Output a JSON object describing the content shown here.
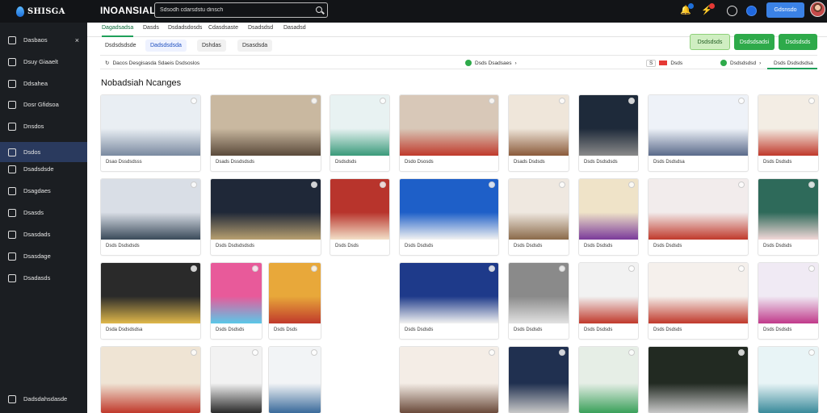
{
  "app": {
    "logo_text": "SHISGA",
    "title": "INOANSIAL"
  },
  "search": {
    "placeholder": "Sdsodh cdarsdstu dinsch"
  },
  "topbar": {
    "button_label": "Gdsnsdo"
  },
  "sidebar": {
    "items": [
      {
        "label": "Dasbaos",
        "icon": "home-icon"
      },
      {
        "label": "Dsuy Giaaelt",
        "icon": "square-icon"
      },
      {
        "label": "Ddsahea",
        "icon": "list-icon"
      },
      {
        "label": "Dosr Gfidsoa",
        "icon": "circle-icon"
      },
      {
        "label": "Dnsdos",
        "icon": "box-icon"
      },
      {
        "label": "Dsdos",
        "icon": "image-icon"
      },
      {
        "label": "Dsadsdsde",
        "icon": "doc-icon"
      },
      {
        "label": "Dsagdaes",
        "icon": "grid-icon"
      },
      {
        "label": "Dsasds",
        "icon": "page-icon"
      },
      {
        "label": "Dsasdads",
        "icon": "folder-icon"
      },
      {
        "label": "Dsasdage",
        "icon": "box-icon"
      },
      {
        "label": "Dsadasds",
        "icon": "share-icon"
      }
    ],
    "footer_label": "Dadsdahsdasde"
  },
  "tabs": [
    {
      "label": "Dagadsadsa"
    },
    {
      "label": "Dasds"
    },
    {
      "label": "Dsdadsdosds"
    },
    {
      "label": "Cdasdsaste"
    },
    {
      "label": "Dsadsdsd"
    },
    {
      "label": "Dasadsd"
    }
  ],
  "subtabs": [
    {
      "label": "Dsdsdsdsde"
    },
    {
      "label": "Dadsdsdsda"
    },
    {
      "label": "Dshdas"
    },
    {
      "label": "Dsasdsda"
    }
  ],
  "actions": [
    {
      "label": "Dsdsdsds"
    },
    {
      "label": "Dsdsdsadsi"
    },
    {
      "label": "Dsdsdsds"
    }
  ],
  "filters": {
    "left": "Dacos Desgisasda Sdaeis Dsdsoslos",
    "status": "Dsds Dsadsaes",
    "sort_left": "S",
    "sort_label": "Dsds",
    "count_label": "Dsdsdsdsd",
    "right_label": "Dsds Dsdsdsdsa"
  },
  "page_title": "Nobadsiah Ncanges",
  "gallery": [
    {
      "caption": "Dsao Dssdsdsss",
      "palette": [
        "#e9eef3",
        "#7a8aa0"
      ]
    },
    {
      "caption": "Dsads Dssdsdsds",
      "palette": [
        "#c9b8a0",
        "#5a4a3a"
      ]
    },
    {
      "caption": "Dsdsdsds",
      "palette": [
        "#e8f2f2",
        "#3a9a7a"
      ]
    },
    {
      "caption": "Dsdo Dsosds",
      "palette": [
        "#d8c8b8",
        "#c0392b"
      ]
    },
    {
      "caption": "Dsads Dsdsds",
      "palette": [
        "#efe6da",
        "#8a5a3a"
      ]
    },
    {
      "caption": "Dsds Dsdsdsds",
      "palette": [
        "#1e2a3a",
        "#8a8a8a"
      ]
    },
    {
      "caption": "Dsds Dsdsdsa",
      "palette": [
        "#eef2f8",
        "#5a6a8a"
      ]
    },
    {
      "caption": "Dsds Dsdsds",
      "palette": [
        "#f3ede4",
        "#c0392b"
      ]
    },
    {
      "caption": "Dsds Dsdsdsds",
      "palette": [
        "#d9dee6",
        "#3a4a5a"
      ]
    },
    {
      "caption": "Dsds Dsdsdsdsds",
      "palette": [
        "#1f2838",
        "#b8a070"
      ]
    },
    {
      "caption": "Dsds Dsds",
      "palette": [
        "#b8342c",
        "#f3e0c8"
      ]
    },
    {
      "caption": "Dsds Dsdsds",
      "palette": [
        "#1e5fc8",
        "#f2f2f2"
      ]
    },
    {
      "caption": "Dsds Dsdsds",
      "palette": [
        "#efe8e0",
        "#8a6a4a"
      ]
    },
    {
      "caption": "Dsds Dsdsds",
      "palette": [
        "#efe3c8",
        "#7a3a9a"
      ]
    },
    {
      "caption": "Dsds Dsdsds",
      "palette": [
        "#f2ecec",
        "#c0392b"
      ]
    },
    {
      "caption": "Dsds Dsdsds",
      "palette": [
        "#2e6a5a",
        "#f2d8d8"
      ]
    },
    {
      "caption": "Dsda Dsdsdsdsa",
      "palette": [
        "#2a2a2a",
        "#e0b84a"
      ]
    },
    {
      "caption": "Dsds Dsdsds",
      "palette": [
        "#e85a9a",
        "#5ac8e8"
      ]
    },
    {
      "caption": "Dsds Dsds",
      "palette": [
        "#e8a83a",
        "#c0392b"
      ]
    },
    {
      "caption": "Dsds Dsdsds",
      "palette": [
        "#1e3a8a",
        "#f2f2f2"
      ]
    },
    {
      "caption": "Dsds Dsdsds",
      "palette": [
        "#8a8a8a",
        "#e2e2e2"
      ]
    },
    {
      "caption": "Dsds Dsdsds",
      "palette": [
        "#f2f2f2",
        "#c0392b"
      ]
    },
    {
      "caption": "Dsds Dsdsds",
      "palette": [
        "#f5f0ec",
        "#c0392b"
      ]
    },
    {
      "caption": "Dsds Dsdsds",
      "palette": [
        "#f0eaf4",
        "#c03a8a"
      ]
    },
    {
      "caption": "Dsds Dsdsds",
      "palette": [
        "#efe4d4",
        "#c0392b"
      ]
    },
    {
      "caption": "",
      "palette": [
        "#f2f2f2",
        "#2a2a2a"
      ]
    },
    {
      "caption": "",
      "palette": [
        "#f2f4f6",
        "#3a6a9a"
      ]
    },
    {
      "caption": "",
      "palette": [
        "#f4ede6",
        "#6a4a3a"
      ]
    },
    {
      "caption": "",
      "palette": [
        "#203050",
        "#c8c8c8"
      ]
    },
    {
      "caption": "",
      "palette": [
        "#e6eee6",
        "#3aa05a"
      ]
    },
    {
      "caption": "",
      "palette": [
        "#222a22",
        "#c8c8c8"
      ]
    },
    {
      "caption": "",
      "palette": [
        "#e8f4f6",
        "#3a8a9a"
      ]
    },
    {
      "caption": "",
      "palette": [
        "#3ab06a",
        "#f2f2f2"
      ]
    },
    {
      "caption": "",
      "palette": [
        "#f2eeea",
        "#3a4aa0"
      ]
    }
  ]
}
